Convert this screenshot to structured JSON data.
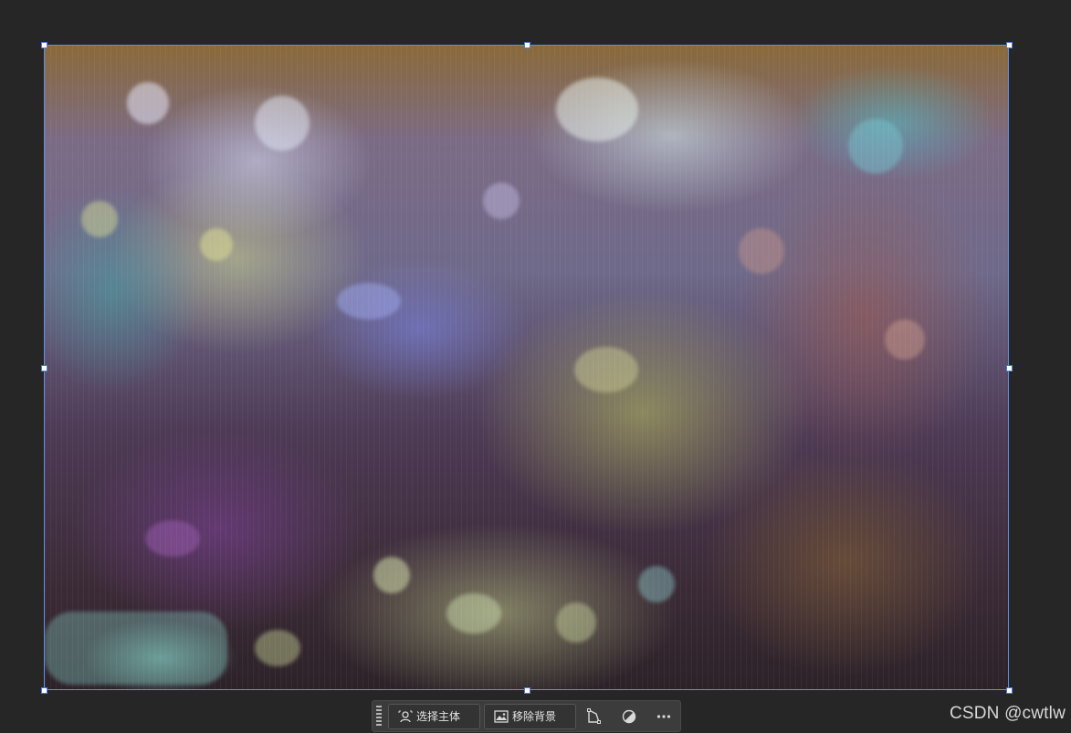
{
  "canvas": {
    "background_color": "#262626",
    "selection_color": "#5b8ee6",
    "image": {
      "description": "macro photo of tangled multicolored yarn/fiber threads with bokeh"
    }
  },
  "taskbar": {
    "select_subject_label": "选择主体",
    "select_subject_icon": "person-icon",
    "remove_bg_label": "移除背景",
    "remove_bg_icon": "image-icon",
    "transform_icon": "transform-icon",
    "adjust_icon": "contrast-icon",
    "more_icon": "more-icon"
  },
  "watermark": {
    "text": "CSDN @cwtlw"
  }
}
